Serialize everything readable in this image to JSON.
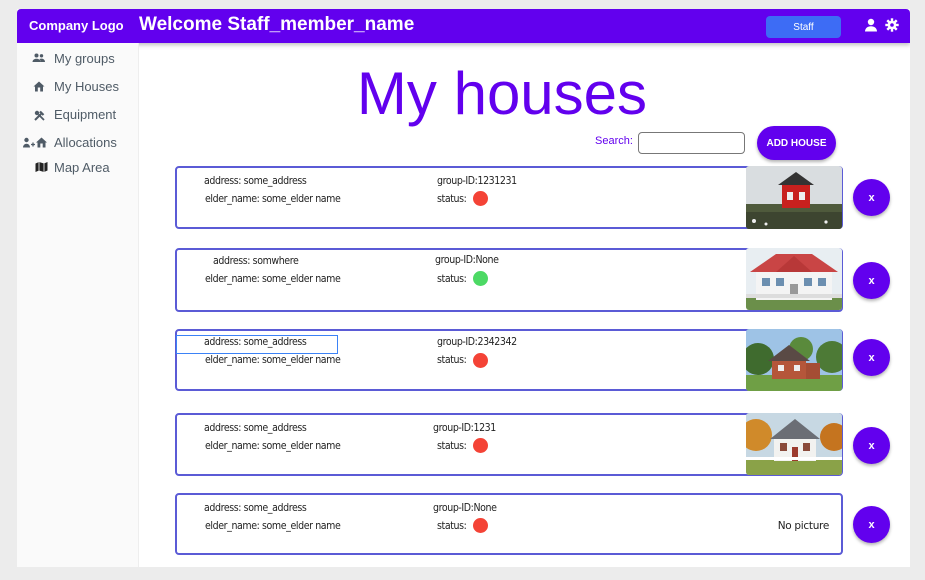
{
  "header": {
    "logo": "Company Logo",
    "welcome": "Welcome Staff_member_name",
    "role_button": "Staff",
    "icons": [
      "person-icon",
      "gear-icon"
    ]
  },
  "sidebar": {
    "items": [
      {
        "label": "My groups",
        "icon": "group-icon"
      },
      {
        "label": "My Houses",
        "icon": "house-icon"
      },
      {
        "label": "Equipment",
        "icon": "tools-icon"
      },
      {
        "label": "Allocations",
        "icon": "people-house-icon"
      },
      {
        "label": "Map Area",
        "icon": "map-icon"
      }
    ]
  },
  "main": {
    "title": "My houses",
    "search_label": "Search:",
    "search_value": "",
    "add_button": "ADD HOUSE",
    "houses": [
      {
        "address": "address: some_address",
        "group": "group-ID:1231231",
        "elder": "elder_name: some_elder name",
        "status_label": "status:",
        "status_color": "#f44336",
        "picture": "red-cabin",
        "delete_label": "x"
      },
      {
        "address": "address: somwhere",
        "group": "group-ID:None",
        "elder": "elder_name: some_elder name",
        "status_label": "status:",
        "status_color": "#4cd964",
        "picture": "white-house",
        "delete_label": "x"
      },
      {
        "address": "address: some_address",
        "group": "group-ID:2342342",
        "elder": "elder_name: some_elder name",
        "status_label": "status:",
        "status_color": "#f44336",
        "picture": "brick-house",
        "delete_label": "x"
      },
      {
        "address": "address: some_address",
        "group": "group-ID:1231",
        "elder": "elder_name: some_elder name",
        "status_label": "status:",
        "status_color": "#f44336",
        "picture": "autumn-house",
        "delete_label": "x"
      },
      {
        "address": "address: some_address",
        "group": "group-ID:None",
        "elder": "elder_name: some_elder name",
        "status_label": "status:",
        "status_color": "#f44336",
        "picture": "none",
        "no_picture_text": "No picture",
        "delete_label": "x"
      }
    ]
  }
}
